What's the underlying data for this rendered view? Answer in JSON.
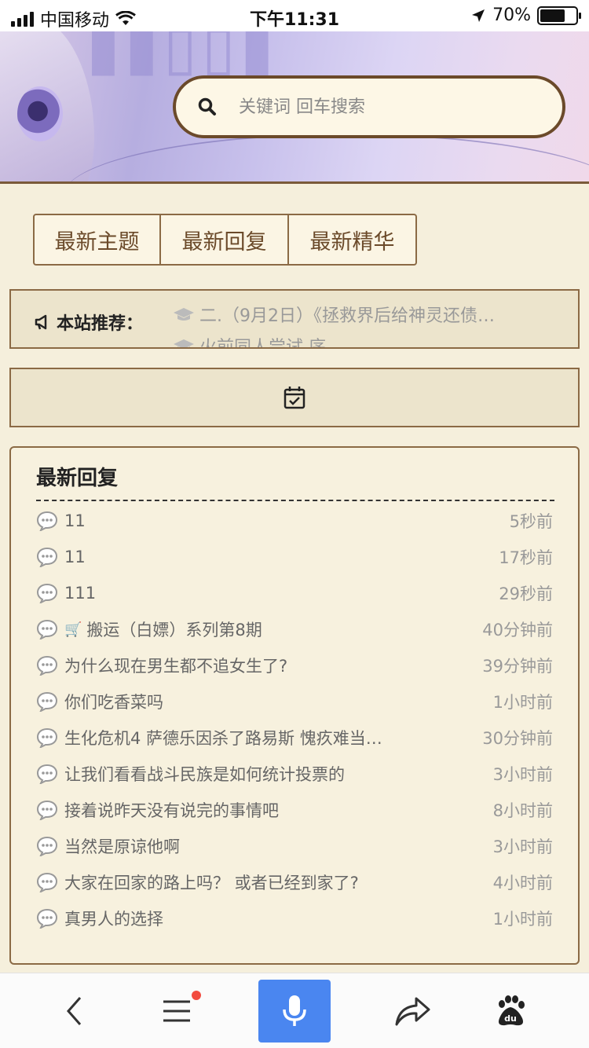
{
  "status_bar": {
    "carrier": "中国移动",
    "time": "下午11:31",
    "battery": "70%",
    "battery_level": 0.7
  },
  "search": {
    "placeholder": "关键词 回车搜索"
  },
  "tabs": [
    {
      "label": "最新主题"
    },
    {
      "label": "最新回复"
    },
    {
      "label": "最新精华"
    }
  ],
  "recommend": {
    "label": "本站推荐：",
    "items": [
      {
        "text": "二.（9月2日）《拯救界后给神灵还债…"
      },
      {
        "text": "火前同人尝试  序"
      }
    ]
  },
  "replies": {
    "title": "最新回复",
    "items": [
      {
        "title": "11",
        "time": "5秒前"
      },
      {
        "title": "11",
        "time": "17秒前"
      },
      {
        "title": "111",
        "time": "29秒前"
      },
      {
        "title": "搬运（白嫖）系列第8期",
        "time": "40分钟前",
        "cart": true
      },
      {
        "title": "为什么现在男生都不追女生了?",
        "time": "39分钟前"
      },
      {
        "title": "你们吃香菜吗",
        "time": "1小时前"
      },
      {
        "title": "生化危机4 萨德乐因杀了路易斯 愧疚难当…",
        "time": "30分钟前"
      },
      {
        "title": "让我们看看战斗民族是如何统计投票的",
        "time": "3小时前"
      },
      {
        "title": "接着说昨天没有说完的事情吧",
        "time": "8小时前"
      },
      {
        "title": "当然是原谅他啊",
        "time": "3小时前"
      },
      {
        "title": "大家在回家的路上吗？ 或者已经到家了?",
        "time": "4小时前"
      },
      {
        "title": "真男人的选择",
        "time": "1小时前"
      }
    ]
  },
  "colors": {
    "background": "#f5efdc",
    "border_brown": "#8b6a45",
    "accent_blue": "#4a86f0"
  }
}
